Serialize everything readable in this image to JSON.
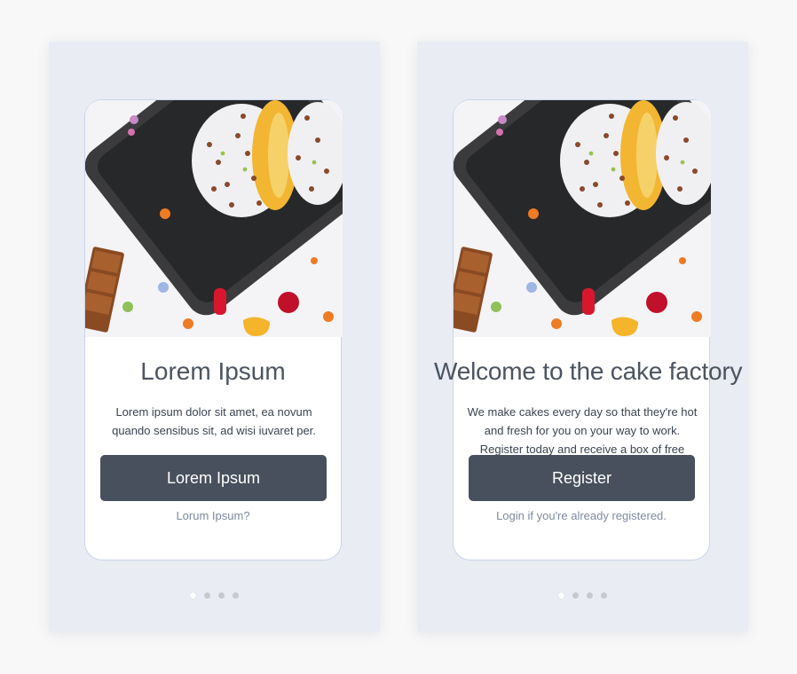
{
  "screens": [
    {
      "title": "Lorem Ipsum",
      "body": "Lorem ipsum dolor sit amet, ea novum quando sensibus sit, ad wisi iuvaret per.",
      "button_label": "Lorem Ipsum",
      "link_text": "Lorum Ipsum?",
      "active_page": 1,
      "total_pages": 4
    },
    {
      "title": "Welcome to the cake factory",
      "body": "We make cakes every day so that they're hot and fresh for you on your way to work. Register today and receive a box of free cakes!",
      "button_label": "Register",
      "link_text": "Login if you're already registered.",
      "active_page": 1,
      "total_pages": 4
    }
  ],
  "colors": {
    "panel_background": "#e9ecf3",
    "button": "#47505c",
    "link": "#7d8a9f",
    "title": "#4b5461"
  },
  "icons": [
    "donut-hero-image",
    "pagination-dot"
  ]
}
